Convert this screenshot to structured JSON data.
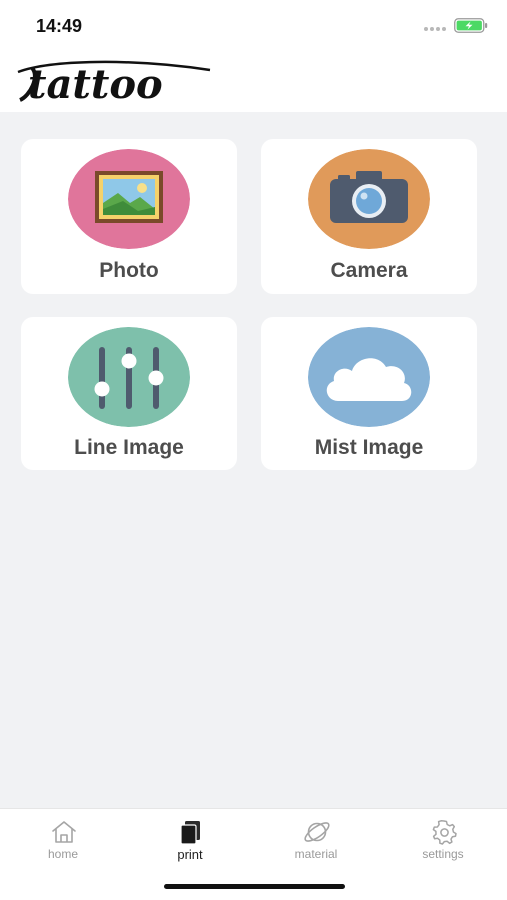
{
  "status_bar": {
    "time": "14:49"
  },
  "header": {
    "logo_text": "tattoo"
  },
  "menu": {
    "items": [
      {
        "label": "Photo",
        "icon": "picture-frame-icon",
        "color": "#e0759b"
      },
      {
        "label": "Camera",
        "icon": "camera-icon",
        "color": "#e09a5a"
      },
      {
        "label": "Line Image",
        "icon": "sliders-icon",
        "color": "#7ec0ab"
      },
      {
        "label": "Mist Image",
        "icon": "cloud-icon",
        "color": "#86b2d6"
      }
    ]
  },
  "tab_bar": {
    "tabs": [
      {
        "label": "home",
        "icon": "home-icon",
        "active": false
      },
      {
        "label": "print",
        "icon": "print-icon",
        "active": true
      },
      {
        "label": "material",
        "icon": "planet-icon",
        "active": false
      },
      {
        "label": "settings",
        "icon": "gear-icon",
        "active": false
      }
    ]
  },
  "colors": {
    "background": "#f1f2f4",
    "card": "#ffffff",
    "label": "#4d4d4d",
    "tab_inactive": "#9a9a9a",
    "tab_active": "#222222",
    "battery": "#4cd964"
  }
}
